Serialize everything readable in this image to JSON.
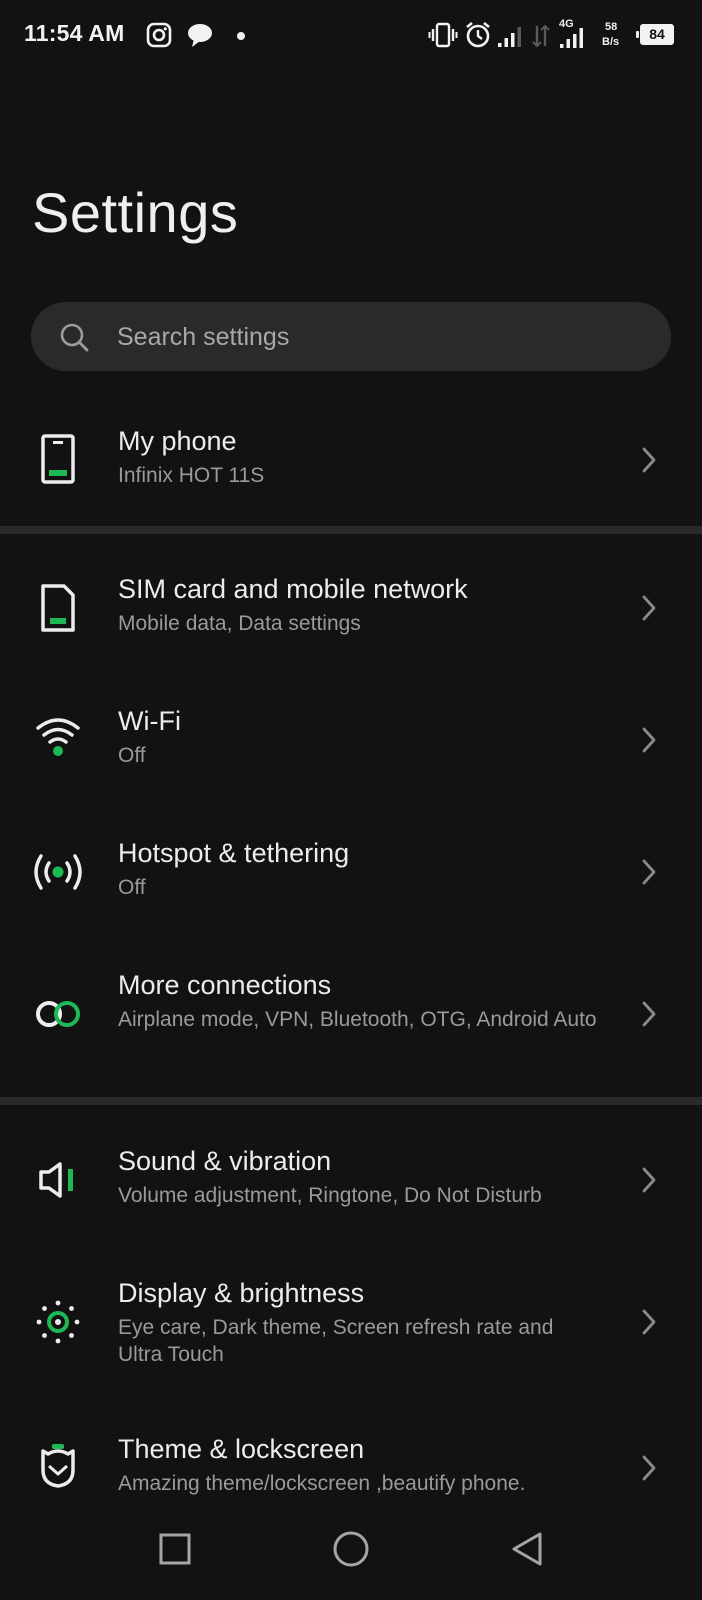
{
  "status_bar": {
    "time": "11:54 AM",
    "network_type": "4G",
    "speed_value": "58",
    "speed_unit": "B/s",
    "battery": "84",
    "icons": [
      "instagram-icon",
      "chat-bubble-icon",
      "notification-dot-icon",
      "vibrate-icon",
      "alarm-icon",
      "signal-icon",
      "data-arrows-icon",
      "signal-4g-icon",
      "battery-icon"
    ]
  },
  "page": {
    "title": "Settings"
  },
  "search": {
    "placeholder": "Search settings",
    "icon": "search-icon"
  },
  "items": [
    {
      "title": "My phone",
      "subtitle": "Infinix HOT 11S",
      "icon": "phone-icon"
    },
    {
      "title": "SIM card and mobile network",
      "subtitle": "Mobile data, Data settings",
      "icon": "sim-card-icon"
    },
    {
      "title": "Wi-Fi",
      "subtitle": "Off",
      "icon": "wifi-icon"
    },
    {
      "title": "Hotspot & tethering",
      "subtitle": "Off",
      "icon": "hotspot-icon"
    },
    {
      "title": "More connections",
      "subtitle": "Airplane mode, VPN, Bluetooth, OTG, Android Auto",
      "icon": "link-icon"
    },
    {
      "title": "Sound & vibration",
      "subtitle": "Volume adjustment, Ringtone, Do Not Disturb",
      "icon": "speaker-icon"
    },
    {
      "title": "Display & brightness",
      "subtitle": "Eye care, Dark theme, Screen refresh rate and Ultra Touch",
      "icon": "brightness-icon"
    },
    {
      "title": "Theme & lockscreen",
      "subtitle": "Amazing theme/lockscreen ,beautify phone.",
      "icon": "theme-icon"
    }
  ],
  "nav_bar": {
    "icons": [
      "recents-button",
      "home-button",
      "back-button"
    ]
  },
  "colors": {
    "background": "#121212",
    "accent": "#1db954",
    "search_bg": "#2a2a2a",
    "divider": "#2a2a2a",
    "subtitle": "#9a9a9a"
  }
}
